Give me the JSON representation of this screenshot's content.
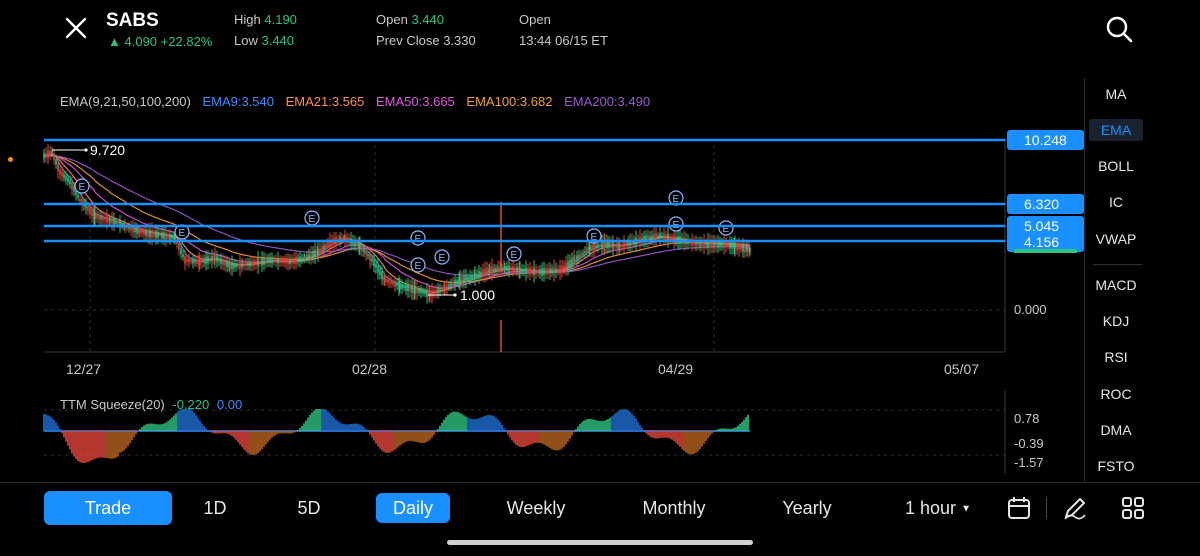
{
  "header": {
    "symbol": "SABS",
    "price": "4.090",
    "change": "+22.82%",
    "stats": [
      {
        "label": "High",
        "value": "4.190",
        "value_color": "#2ec27e"
      },
      {
        "label": "Low",
        "value": "3.440",
        "value_color": "#2ec27e"
      },
      {
        "label": "Open",
        "value": "3.440",
        "value_color": "#2ec27e"
      },
      {
        "label": "Prev Close",
        "value": "3.330",
        "value_color": "#c8c8c8"
      },
      {
        "label": "Open",
        "value": "",
        "value_color": "#c8c8c8"
      },
      {
        "label": "13:44 06/15 ET",
        "value": "",
        "value_color": "#c8c8c8"
      }
    ]
  },
  "ema_legend": {
    "title": "EMA(9,21,50,100,200)",
    "lines": [
      {
        "text": "EMA9:3.540",
        "color": "#3d8bff"
      },
      {
        "text": "EMA21:3.565",
        "color": "#ff8a5c"
      },
      {
        "text": "EMA50:3.665",
        "color": "#e057e0"
      },
      {
        "text": "EMA100:3.682",
        "color": "#f0a030"
      },
      {
        "text": "EMA200:3.490",
        "color": "#9b59d0"
      }
    ]
  },
  "price_levels": [
    {
      "label": "10.248",
      "value": 10.248
    },
    {
      "label": "6.320",
      "value": 6.32
    },
    {
      "label": "5.045",
      "value": 5.045
    },
    {
      "label": "4.156",
      "value": 4.156
    }
  ],
  "price_axis_zero": "0.000",
  "annotations": {
    "high_label": "9.720",
    "low_label": "1.000",
    "event_marker": "E"
  },
  "x_axis_labels": [
    "12/27",
    "02/28",
    "04/29",
    "05/07"
  ],
  "squeeze": {
    "title": "TTM Squeeze(20)",
    "value1": "-0.220",
    "value2": "0.00",
    "value1_color": "#2ec27e",
    "value2_color": "#3d8bff",
    "axis_labels": [
      "0.78",
      "-0.39",
      "-1.57"
    ]
  },
  "side_menu": {
    "overlays": [
      "MA",
      "EMA",
      "BOLL",
      "IC",
      "VWAP"
    ],
    "active": "EMA",
    "indicators": [
      "MACD",
      "KDJ",
      "RSI",
      "ROC",
      "DMA",
      "FSTO"
    ]
  },
  "bottom_bar": {
    "trade": "Trade",
    "timeframes": [
      "1D",
      "5D",
      "Daily",
      "Weekly",
      "Monthly",
      "Yearly"
    ],
    "active": "Daily",
    "interval": "1 hour"
  },
  "colors": {
    "accent": "#1a90ff",
    "up": "#2ec27e",
    "down": "#e0453a",
    "level_line": "#1a90ff"
  },
  "icons": {
    "close": "close-icon",
    "search": "search-icon",
    "calendar": "calendar-icon",
    "draw": "pen-icon",
    "layout": "grid-icon"
  }
}
